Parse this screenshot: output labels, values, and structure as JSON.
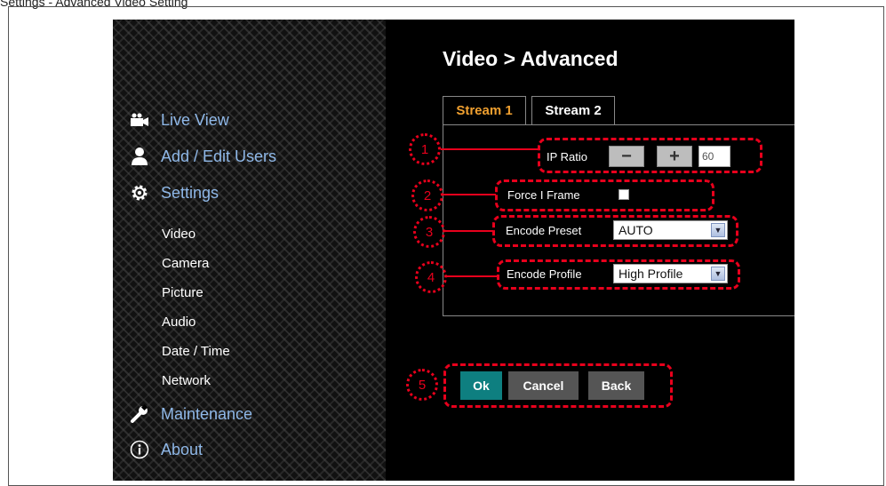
{
  "caption": "Settings - Advanced Video Setting",
  "nav": {
    "live_view": "Live View",
    "add_edit_users": "Add / Edit Users",
    "settings": "Settings",
    "sub": [
      "Video",
      "Camera",
      "Picture",
      "Audio",
      "Date / Time",
      "Network"
    ],
    "maintenance": "Maintenance",
    "about": "About"
  },
  "page_title": "Video > Advanced",
  "tabs": [
    {
      "label": "Stream 1",
      "active": true
    },
    {
      "label": "Stream 2",
      "active": false
    }
  ],
  "form": {
    "ip_ratio_label": "IP Ratio",
    "minus_label": "−",
    "plus_label": "+",
    "ip_ratio_value": "60",
    "force_i_frame_label": "Force I Frame",
    "force_i_frame_checked": false,
    "encode_preset_label": "Encode Preset",
    "encode_preset_value": "AUTO",
    "encode_profile_label": "Encode Profile",
    "encode_profile_value": "High Profile"
  },
  "actions": {
    "ok": "Ok",
    "cancel": "Cancel",
    "back": "Back"
  },
  "callouts": [
    "1",
    "2",
    "3",
    "4",
    "5"
  ],
  "colors": {
    "annotation_red": "#e8001c",
    "active_tab": "#f0a030",
    "nav_blue": "#8fb8e8",
    "ok_teal": "#0e7f80",
    "button_gray": "#555555"
  }
}
